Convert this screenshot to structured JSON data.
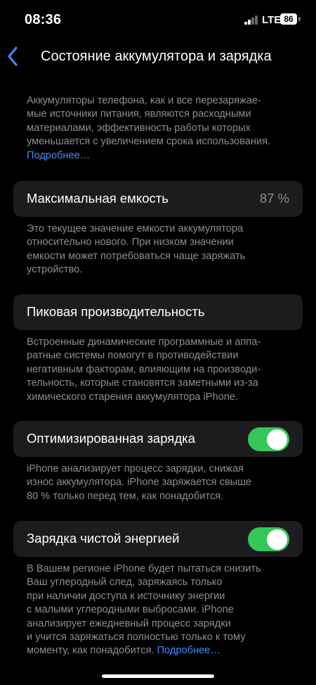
{
  "status_bar": {
    "time": "08:36",
    "network": "LTE",
    "battery_level": "86"
  },
  "nav": {
    "title": "Состояние аккумулятора и зарядка"
  },
  "intro": {
    "lines": [
      "Аккумуляторы телефона, как и все перезаряжае-",
      "мые источники питания, являются расходными",
      "материалами, эффективность работы которых",
      "уменьшается с увеличением срока использования."
    ],
    "link": "Подробнее…"
  },
  "max_capacity": {
    "label": "Максимальная емкость",
    "value": "87 %",
    "footer_lines": [
      "Это текущее значение емкости аккумулятора",
      "относительно нового. При низком значении",
      "емкости может потребоваться чаще заряжать",
      "устройство."
    ]
  },
  "peak_performance": {
    "label": "Пиковая производительность",
    "footer_lines": [
      "Встроенные динамические программные и аппа-",
      "ратные системы помогут в противодействии",
      "негативным факторам, влияющим на производи-",
      "тельность, которые становятся заметными из-за",
      "химического старения аккумулятора iPhone."
    ]
  },
  "optimized_charging": {
    "label": "Оптимизированная зарядка",
    "enabled": true,
    "footer_lines": [
      "iPhone анализирует процесс зарядки, снижая",
      "износ аккумулятора. iPhone заряжается свыше",
      "80 % только перед тем, как понадобится."
    ]
  },
  "clean_energy": {
    "label": "Зарядка чистой энергией",
    "enabled": true,
    "footer_lines": [
      "В Вашем регионе iPhone будет пытаться снизить",
      "Ваш углеродный след, заряжаясь только",
      "при наличии доступа к источнику энергии",
      "с малыми углеродными выбросами. iPhone",
      "анализирует ежедневный процесс зарядки",
      "и учится заряжаться полностью только к тому"
    ],
    "last_line": "моменту, как понадобится.",
    "link": "Подробнее…"
  },
  "colors": {
    "background": "#000000",
    "cell": "#1c1c1e",
    "secondary_text": "#8d8d93",
    "accent": "#3d8bfd",
    "toggle_on": "#34c759"
  },
  "icons": {
    "back": "chevron-left-icon",
    "signal": "cellular-signal-icon",
    "battery": "battery-icon"
  }
}
